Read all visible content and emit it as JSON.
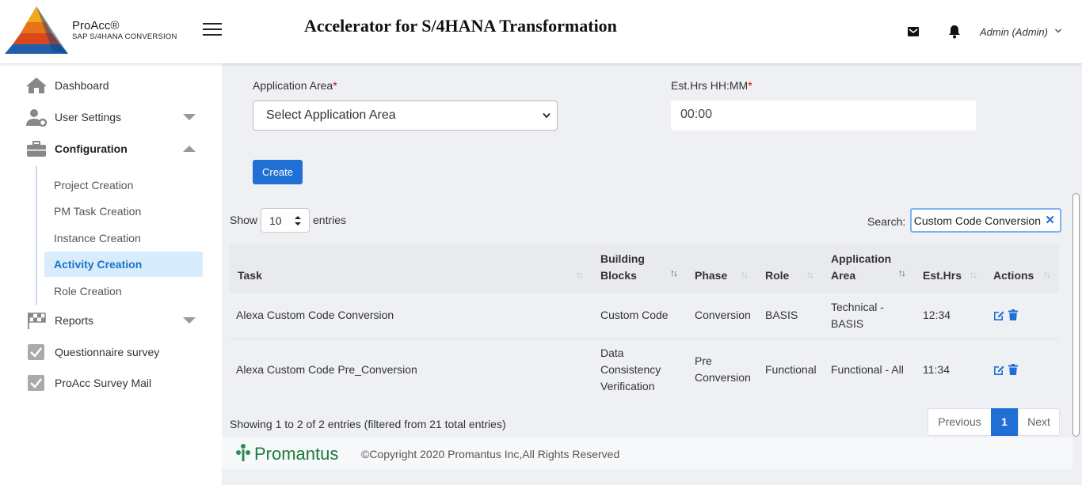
{
  "header": {
    "brand": "ProAcc®",
    "brand_sub": "SAP S/4HANA CONVERSION",
    "title": "Accelerator for S/4HANA Transformation",
    "user": "Admin (Admin)"
  },
  "sidebar": {
    "dashboard": "Dashboard",
    "user_settings": "User Settings",
    "configuration": "Configuration",
    "sub": [
      "Project Creation",
      "PM Task Creation",
      "Instance Creation",
      "Activity Creation",
      "Role Creation"
    ],
    "reports": "Reports",
    "questionnaire": "Questionnaire survey",
    "survey_mail": "ProAcc Survey Mail"
  },
  "form": {
    "app_area_label": "Application Area",
    "app_area_value": "Select Application Area",
    "est_label": "Est.Hrs HH:MM",
    "est_value": "00:00",
    "required_mark": "*",
    "create": "Create"
  },
  "table": {
    "show": "Show",
    "length": "10",
    "entries": "entries",
    "search_label": "Search:",
    "search_value": "Custom Code Conversion",
    "headers": {
      "task": "Task",
      "bb1": "Building",
      "bb2": "Blocks",
      "phase": "Phase",
      "role": "Role",
      "aa1": "Application",
      "aa2": "Area",
      "est": "Est.Hrs",
      "actions": "Actions"
    },
    "rows": [
      {
        "task": "Alexa Custom Code Conversion",
        "bb": [
          "Custom Code"
        ],
        "phase": [
          "Conversion"
        ],
        "role": "BASIS",
        "area": [
          "Technical -",
          "BASIS"
        ],
        "est": "12:34"
      },
      {
        "task": "Alexa Custom Code Pre_Conversion",
        "bb": [
          "Data",
          "Consistency",
          "Verification"
        ],
        "phase": [
          "Pre",
          "Conversion"
        ],
        "role": "Functional",
        "area": [
          "Functional - All"
        ],
        "est": "11:34"
      }
    ],
    "info": "Showing 1 to 2 of 2 entries (filtered from 21 total entries)",
    "prev": "Previous",
    "page": "1",
    "next": "Next"
  },
  "footer": {
    "logo_text": "Promantus",
    "copyright": "©Copyright 2020 Promantus Inc,All Rights Reserved"
  },
  "colors": {
    "accent": "#1f6fd4",
    "active_bg": "#d9ecfb"
  }
}
